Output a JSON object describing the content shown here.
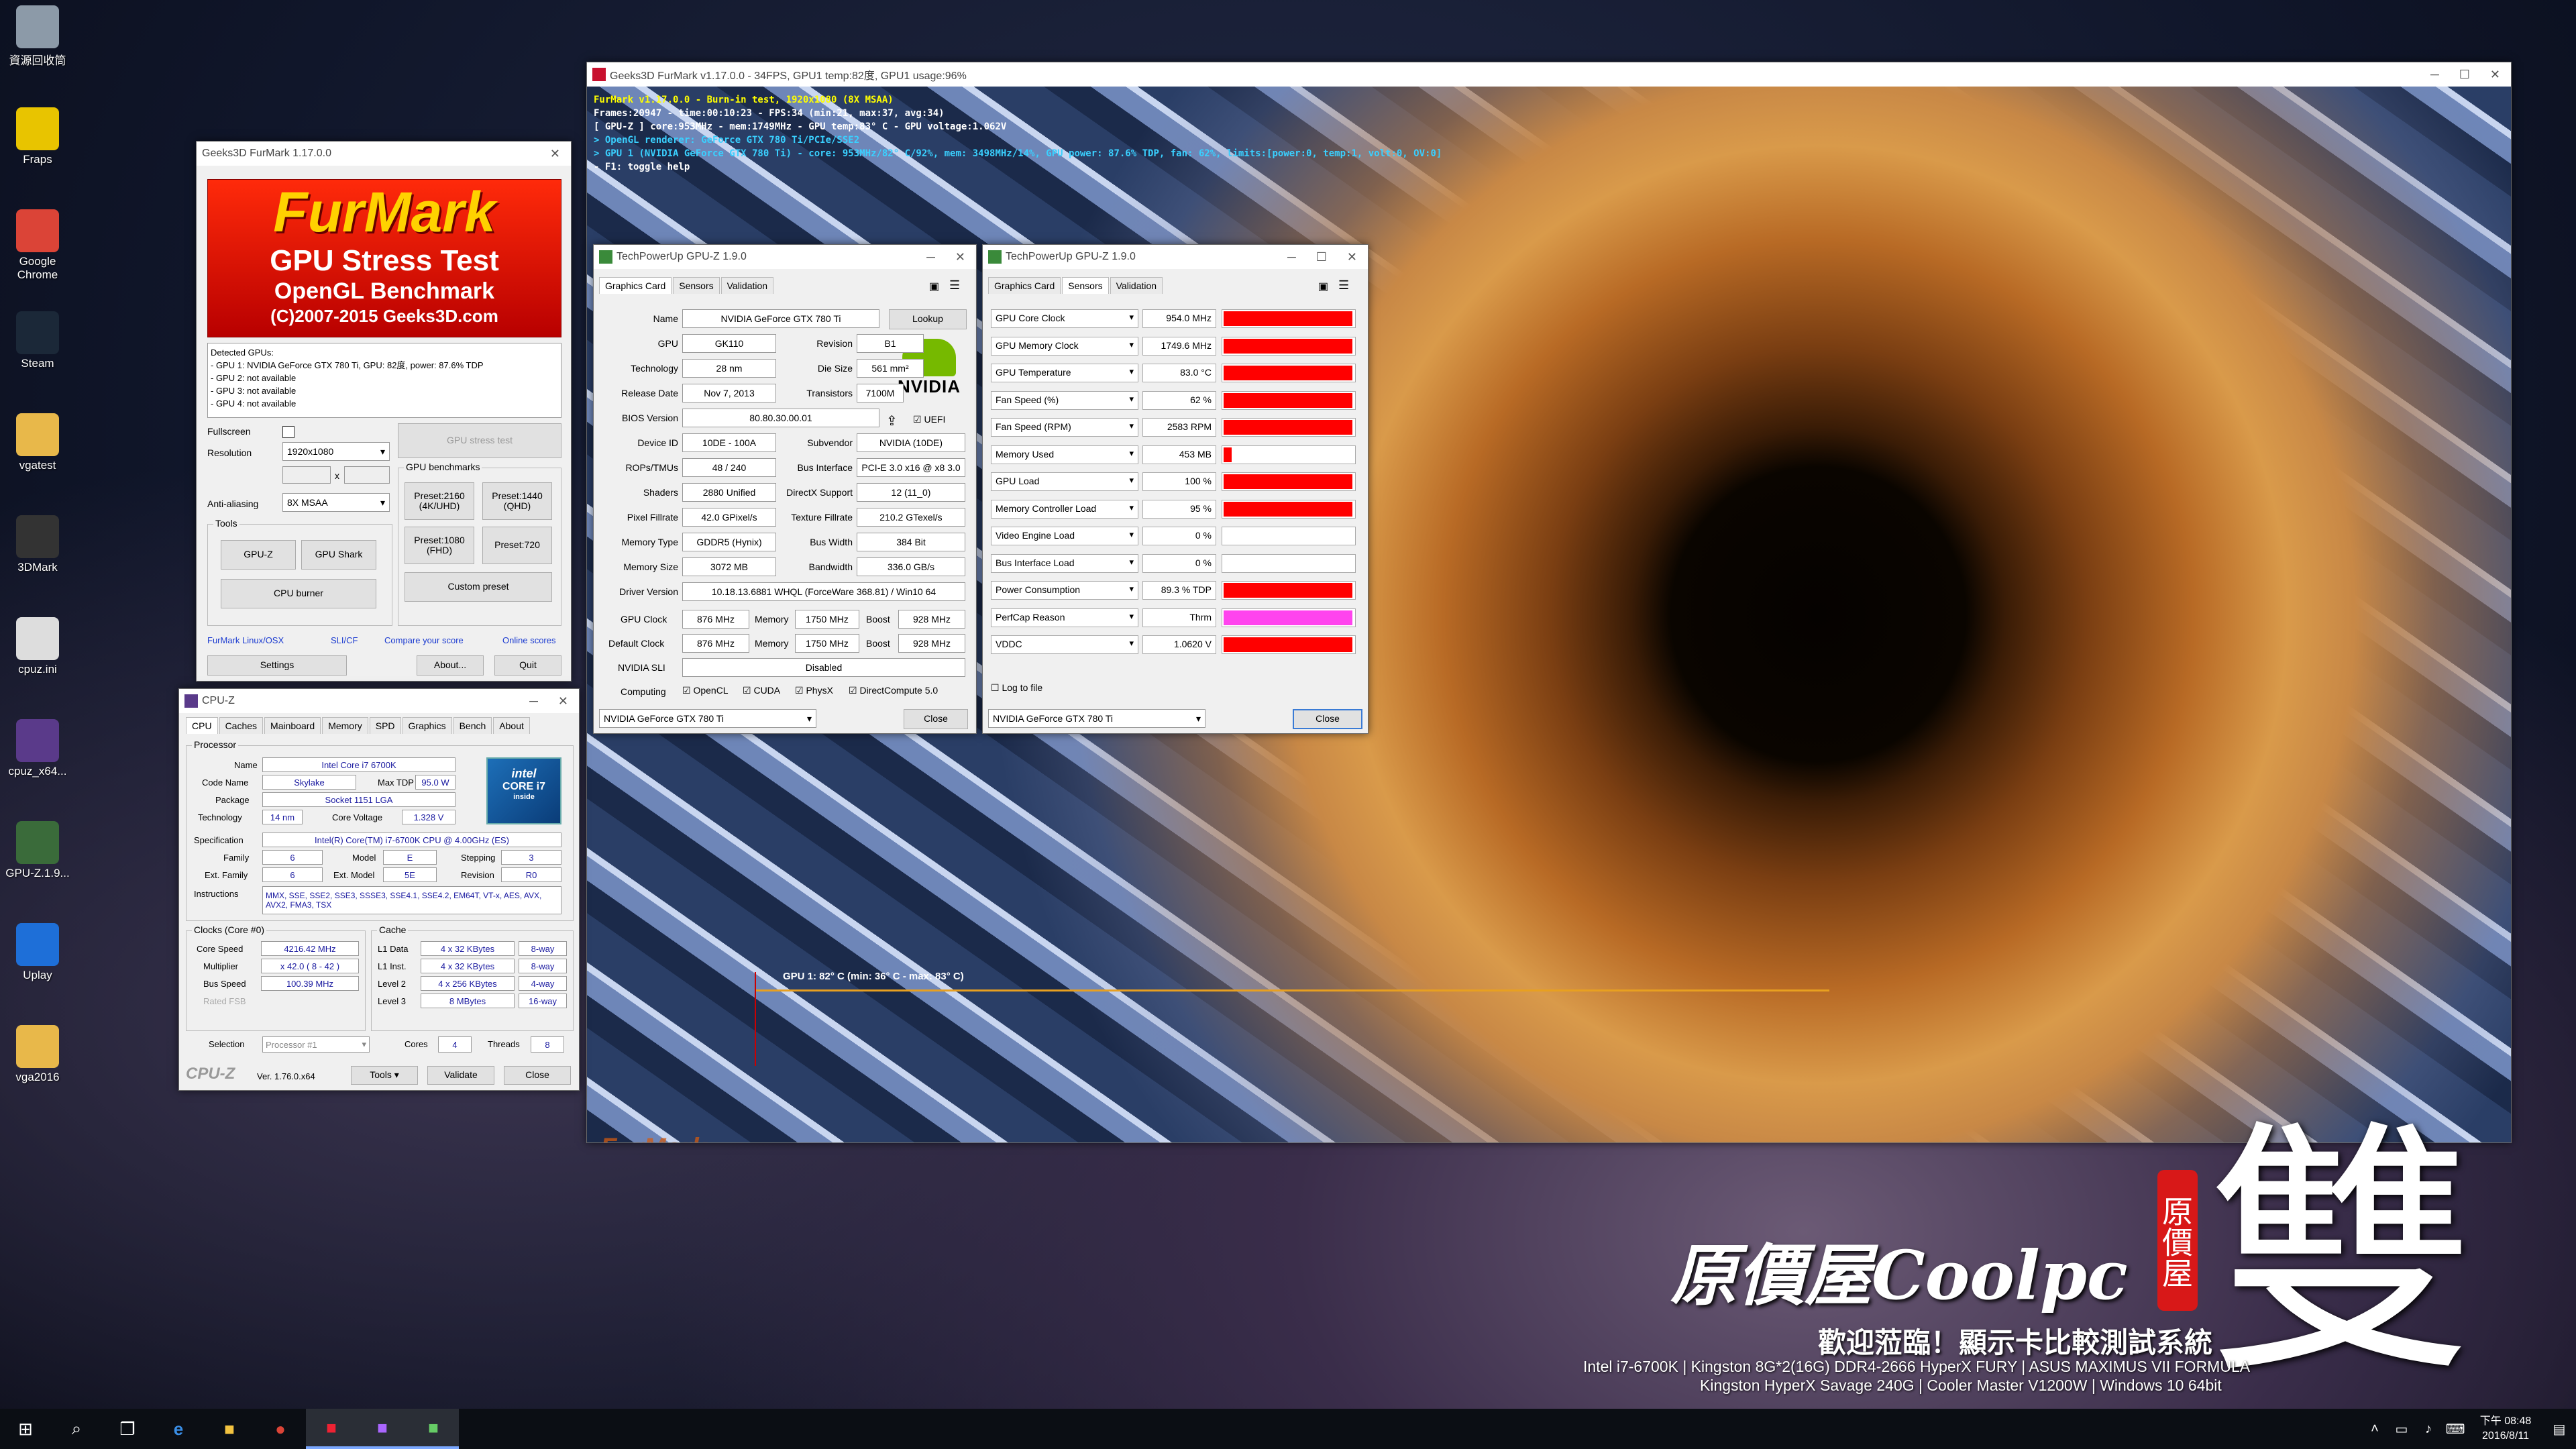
{
  "desktop_icons": [
    {
      "label": "資源回收筒",
      "color": "#8c9aa8"
    },
    {
      "label": "Fraps",
      "color": "#e8c400"
    },
    {
      "label": "Google Chrome",
      "color": "#db4437"
    },
    {
      "label": "Steam",
      "color": "#1b2838"
    },
    {
      "label": "vgatest",
      "color": "#e8b84a"
    },
    {
      "label": "3DMark",
      "color": "#333"
    },
    {
      "label": "cpuz.ini",
      "color": "#ddd"
    },
    {
      "label": "cpuz_x64...",
      "color": "#5a3a8a"
    },
    {
      "label": "GPU-Z.1.9...",
      "color": "#3a6b3a"
    },
    {
      "label": "Uplay",
      "color": "#1e6fd8"
    },
    {
      "label": "vga2016",
      "color": "#e8b84a"
    }
  ],
  "furmark_main": {
    "title": "Geeks3D FurMark v1.17.0.0 - 34FPS, GPU1 temp:82度, GPU1 usage:96%",
    "overlay": [
      "FurMark v1.17.0.0 - Burn-in test, 1920x1080 (8X MSAA)",
      "Frames:20947 - time:00:10:23 - FPS:34 (min:21, max:37, avg:34)",
      "[ GPU-Z ] core:953MHz - mem:1749MHz - GPU temp:83° C - GPU voltage:1.062V",
      "> OpenGL renderer: GeForce GTX 780 Ti/PCIe/SSE2",
      "> GPU 1 (NVIDIA GeForce GTX 780 Ti) - core: 953MHz/82° C/92%, mem: 3498MHz/14%, GPU power: 87.6% TDP, fan: 62%, limits:[power:0, temp:1, volt:0, OV:0]",
      "- F1: toggle help"
    ],
    "graph_label": "GPU 1: 82° C (min: 36° C - max: 83° C)",
    "watermark": "FurMark"
  },
  "furmark_panel": {
    "title": "Geeks3D FurMark 1.17.0.0",
    "banner_title": "FurMark",
    "banner_sub1": "GPU Stress Test",
    "banner_sub2": "OpenGL Benchmark",
    "banner_sub3": "(C)2007-2015 Geeks3D.com",
    "detected": [
      "Detected GPUs:",
      "- GPU 1: NVIDIA GeForce GTX 780 Ti, GPU: 82度, power: 87.6% TDP",
      "- GPU 2: not available",
      "- GPU 3: not available",
      "- GPU 4: not available"
    ],
    "fullscreen": "Fullscreen",
    "resolution_label": "Resolution",
    "resolution": "1920x1080",
    "x": "x",
    "aa_label": "Anti-aliasing",
    "aa": "8X MSAA",
    "stress_btn": "GPU stress test",
    "bench_label": "GPU benchmarks",
    "p2160": "Preset:2160 (4K/UHD)",
    "p1440": "Preset:1440 (QHD)",
    "p1080": "Preset:1080 (FHD)",
    "p720": "Preset:720",
    "custom": "Custom preset",
    "tools_label": "Tools",
    "gpuz": "GPU-Z",
    "gpushark": "GPU Shark",
    "cpuburner": "CPU burner",
    "link1": "FurMark Linux/OSX",
    "link2": "SLI/CF",
    "link3": "Compare your score",
    "link4": "Online scores",
    "settings": "Settings",
    "about": "About...",
    "quit": "Quit"
  },
  "cpuz": {
    "title": "CPU-Z",
    "tabs": [
      "CPU",
      "Caches",
      "Mainboard",
      "Memory",
      "SPD",
      "Graphics",
      "Bench",
      "About"
    ],
    "processor": "Processor",
    "name_l": "Name",
    "name": "Intel Core i7 6700K",
    "code_l": "Code Name",
    "code": "Skylake",
    "tdp_l": "Max TDP",
    "tdp": "95.0 W",
    "pkg_l": "Package",
    "pkg": "Socket 1151 LGA",
    "tech_l": "Technology",
    "tech": "14 nm",
    "cv_l": "Core Voltage",
    "cv": "1.328 V",
    "spec_l": "Specification",
    "spec": "Intel(R) Core(TM) i7-6700K CPU @ 4.00GHz (ES)",
    "fam_l": "Family",
    "fam": "6",
    "mod_l": "Model",
    "mod": "E",
    "step_l": "Stepping",
    "step": "3",
    "efam_l": "Ext. Family",
    "efam": "6",
    "emod_l": "Ext. Model",
    "emod": "5E",
    "rev_l": "Revision",
    "rev": "R0",
    "ins_l": "Instructions",
    "ins": "MMX, SSE, SSE2, SSE3, SSSE3, SSE4.1, SSE4.2, EM64T, VT-x, AES, AVX, AVX2, FMA3, TSX",
    "clocks": "Clocks (Core #0)",
    "cs_l": "Core Speed",
    "cs": "4216.42 MHz",
    "mul_l": "Multiplier",
    "mul": "x 42.0 ( 8 - 42 )",
    "bus_l": "Bus Speed",
    "bus": "100.39 MHz",
    "fsb_l": "Rated FSB",
    "cache": "Cache",
    "l1d_l": "L1 Data",
    "l1d": "4 x 32 KBytes",
    "l1d_w": "8-way",
    "l1i_l": "L1 Inst.",
    "l1i": "4 x 32 KBytes",
    "l1i_w": "8-way",
    "l2_l": "Level 2",
    "l2": "4 x 256 KBytes",
    "l2_w": "4-way",
    "l3_l": "Level 3",
    "l3": "8 MBytes",
    "l3_w": "16-way",
    "sel_l": "Selection",
    "sel": "Processor #1",
    "cores_l": "Cores",
    "cores": "4",
    "thr_l": "Threads",
    "thr": "8",
    "brand": "CPU-Z",
    "ver": "Ver. 1.76.0.x64",
    "tools": "Tools",
    "validate": "Validate",
    "close": "Close",
    "intel1": "intel",
    "intel2": "CORE i7",
    "intel3": "inside"
  },
  "gpuz1": {
    "title": "TechPowerUp GPU-Z 1.9.0",
    "tabs": [
      "Graphics Card",
      "Sensors",
      "Validation"
    ],
    "rows": [
      {
        "l": "Name",
        "v": "NVIDIA GeForce GTX 780 Ti"
      },
      {
        "l": "GPU",
        "v": "GK110",
        "l2": "Revision",
        "v2": "B1"
      },
      {
        "l": "Technology",
        "v": "28 nm",
        "l2": "Die Size",
        "v2": "561 mm²"
      },
      {
        "l": "Release Date",
        "v": "Nov 7, 2013",
        "l2": "Transistors",
        "v2": "7100M"
      },
      {
        "l": "BIOS Version",
        "v": "80.80.30.00.01"
      },
      {
        "l": "Device ID",
        "v": "10DE - 100A",
        "l2": "Subvendor",
        "v2": "NVIDIA (10DE)"
      },
      {
        "l": "ROPs/TMUs",
        "v": "48 / 240",
        "l2": "Bus Interface",
        "v2": "PCI-E 3.0 x16 @ x8 3.0"
      },
      {
        "l": "Shaders",
        "v": "2880 Unified",
        "l2": "DirectX Support",
        "v2": "12 (11_0)"
      },
      {
        "l": "Pixel Fillrate",
        "v": "42.0 GPixel/s",
        "l2": "Texture Fillrate",
        "v2": "210.2 GTexel/s"
      },
      {
        "l": "Memory Type",
        "v": "GDDR5 (Hynix)",
        "l2": "Bus Width",
        "v2": "384 Bit"
      },
      {
        "l": "Memory Size",
        "v": "3072 MB",
        "l2": "Bandwidth",
        "v2": "336.0 GB/s"
      },
      {
        "l": "Driver Version",
        "v": "10.18.13.6881 WHQL (ForceWare 368.81) / Win10 64"
      }
    ],
    "gclk_l": "GPU Clock",
    "gclk": "876 MHz",
    "mem_l": "Memory",
    "mem": "1750 MHz",
    "boost_l": "Boost",
    "boost": "928 MHz",
    "dclk_l": "Default Clock",
    "dclk": "876 MHz",
    "dmem": "1750 MHz",
    "dboost": "928 MHz",
    "sli_l": "NVIDIA SLI",
    "sli": "Disabled",
    "comp_l": "Computing",
    "opencl": "OpenCL",
    "cuda": "CUDA",
    "physx": "PhysX",
    "dc": "DirectCompute 5.0",
    "lookup": "Lookup",
    "uefi": "UEFI",
    "nvidia": "NVIDIA",
    "select": "NVIDIA GeForce GTX 780 Ti",
    "close": "Close",
    "question": "?"
  },
  "gpuz2": {
    "title": "TechPowerUp GPU-Z 1.9.0",
    "tabs": [
      "Graphics Card",
      "Sensors",
      "Validation"
    ],
    "sensors": [
      {
        "n": "GPU Core Clock",
        "v": "954.0 MHz",
        "f": 0.99,
        "c": "#ff0000"
      },
      {
        "n": "GPU Memory Clock",
        "v": "1749.6 MHz",
        "f": 0.99,
        "c": "#ff0000"
      },
      {
        "n": "GPU Temperature",
        "v": "83.0 °C",
        "f": 0.99,
        "c": "#ff0000"
      },
      {
        "n": "Fan Speed (%)",
        "v": "62 %",
        "f": 0.99,
        "c": "#ff0000"
      },
      {
        "n": "Fan Speed (RPM)",
        "v": "2583 RPM",
        "f": 0.99,
        "c": "#ff0000"
      },
      {
        "n": "Memory Used",
        "v": "453 MB",
        "f": 0.06,
        "c": "#ff0000"
      },
      {
        "n": "GPU Load",
        "v": "100 %",
        "f": 0.99,
        "c": "#ff0000"
      },
      {
        "n": "Memory Controller Load",
        "v": "95 %",
        "f": 0.99,
        "c": "#ff0000"
      },
      {
        "n": "Video Engine Load",
        "v": "0 %",
        "f": 0,
        "c": "#ff0000"
      },
      {
        "n": "Bus Interface Load",
        "v": "0 %",
        "f": 0,
        "c": "#ff0000"
      },
      {
        "n": "Power Consumption",
        "v": "89.3 % TDP",
        "f": 0.99,
        "c": "#ff0000"
      },
      {
        "n": "PerfCap Reason",
        "v": "Thrm",
        "f": 0.99,
        "c": "#ff44ee"
      },
      {
        "n": "VDDC",
        "v": "1.0620 V",
        "f": 0.99,
        "c": "#ff0000"
      }
    ],
    "log": "Log to file",
    "select": "NVIDIA GeForce GTX 780 Ti",
    "close": "Close"
  },
  "branding": {
    "logo": "原價屋Coolpc",
    "seal": "原價屋",
    "big": "雙",
    "welcome": "歡迎蒞臨！顯示卡比較測試系統",
    "spec1": "Intel i7-6700K | Kingston 8G*2(16G) DDR4-2666 HyperX FURY | ASUS MAXIMUS VII FORMULA",
    "spec2": "Kingston HyperX Savage 240G | Cooler Master V1200W | Windows 10 64bit"
  },
  "taskbar": {
    "time1": "下午 08:48",
    "time2": "2016/8/11"
  }
}
